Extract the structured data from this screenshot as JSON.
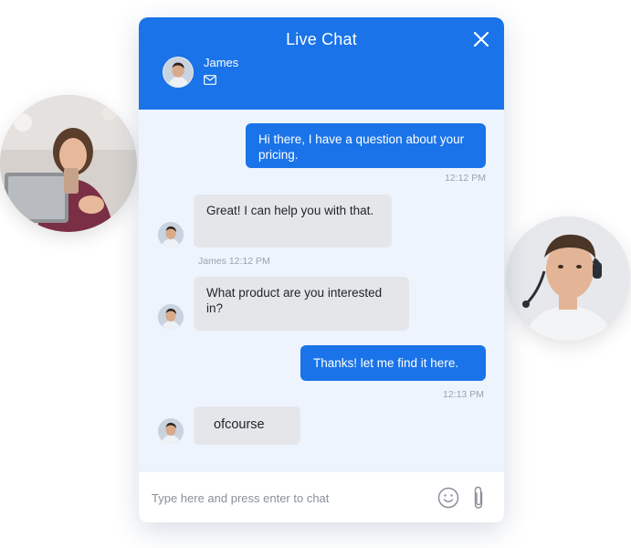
{
  "header": {
    "title": "Live Chat",
    "agent_name": "James"
  },
  "messages": [
    {
      "from": "visitor",
      "text": "Hi there, I have a question about your pricing.",
      "time": "12:12 PM"
    },
    {
      "from": "agent",
      "text": "Great! I can help you with that.",
      "meta": "James 12:12 PM"
    },
    {
      "from": "agent",
      "text": "What product are you interested in?"
    },
    {
      "from": "visitor",
      "text": "Thanks! let me find it here.",
      "time": "12:13 PM"
    },
    {
      "from": "agent",
      "text": "ofcourse"
    }
  ],
  "composer": {
    "placeholder": "Type here and press enter to chat"
  },
  "icons": {
    "close": "close-icon",
    "mail": "mail-icon",
    "emoji": "emoji-icon",
    "attach": "paperclip-icon"
  },
  "colors": {
    "accent": "#1a73e8",
    "chat_background": "#eef4fd",
    "agent_bubble": "#e4e6ea"
  }
}
